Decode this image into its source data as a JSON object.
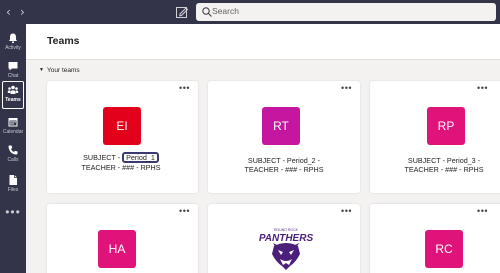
{
  "search": {
    "placeholder": "Search"
  },
  "rail": {
    "items": [
      {
        "label": "Activity",
        "icon": "bell-icon"
      },
      {
        "label": "Chat",
        "icon": "chat-icon"
      },
      {
        "label": "Teams",
        "icon": "teams-icon"
      },
      {
        "label": "Calendar",
        "icon": "calendar-icon"
      },
      {
        "label": "Calls",
        "icon": "phone-icon"
      },
      {
        "label": "Files",
        "icon": "file-icon"
      }
    ],
    "more": "•••"
  },
  "page": {
    "title": "Teams",
    "section": "Your teams"
  },
  "teams": [
    {
      "initials": "EI",
      "color": "#e3001b",
      "line1_pre": "SUBJECT - ",
      "line1_hl": "Period_1",
      "line2": "TEACHER - ### - RPHS"
    },
    {
      "initials": "RT",
      "color": "#c4169f",
      "line1": "SUBJECT - Period_2 -",
      "line2": "TEACHER - ### - RPHS"
    },
    {
      "initials": "RP",
      "color": "#e0137a",
      "line1": "SUBJECT - Period_3 -",
      "line2": "TEACHER - ### - RPHS"
    },
    {
      "initials": "HA",
      "color": "#e0137a"
    },
    {
      "logo_text": "PANTHERS",
      "logo_sub": "ROUND ROCK"
    },
    {
      "initials": "RC",
      "color": "#e0137a"
    }
  ],
  "card_more": "•••",
  "colors": {
    "rail": "#33344a",
    "accent": "#6264a7"
  }
}
